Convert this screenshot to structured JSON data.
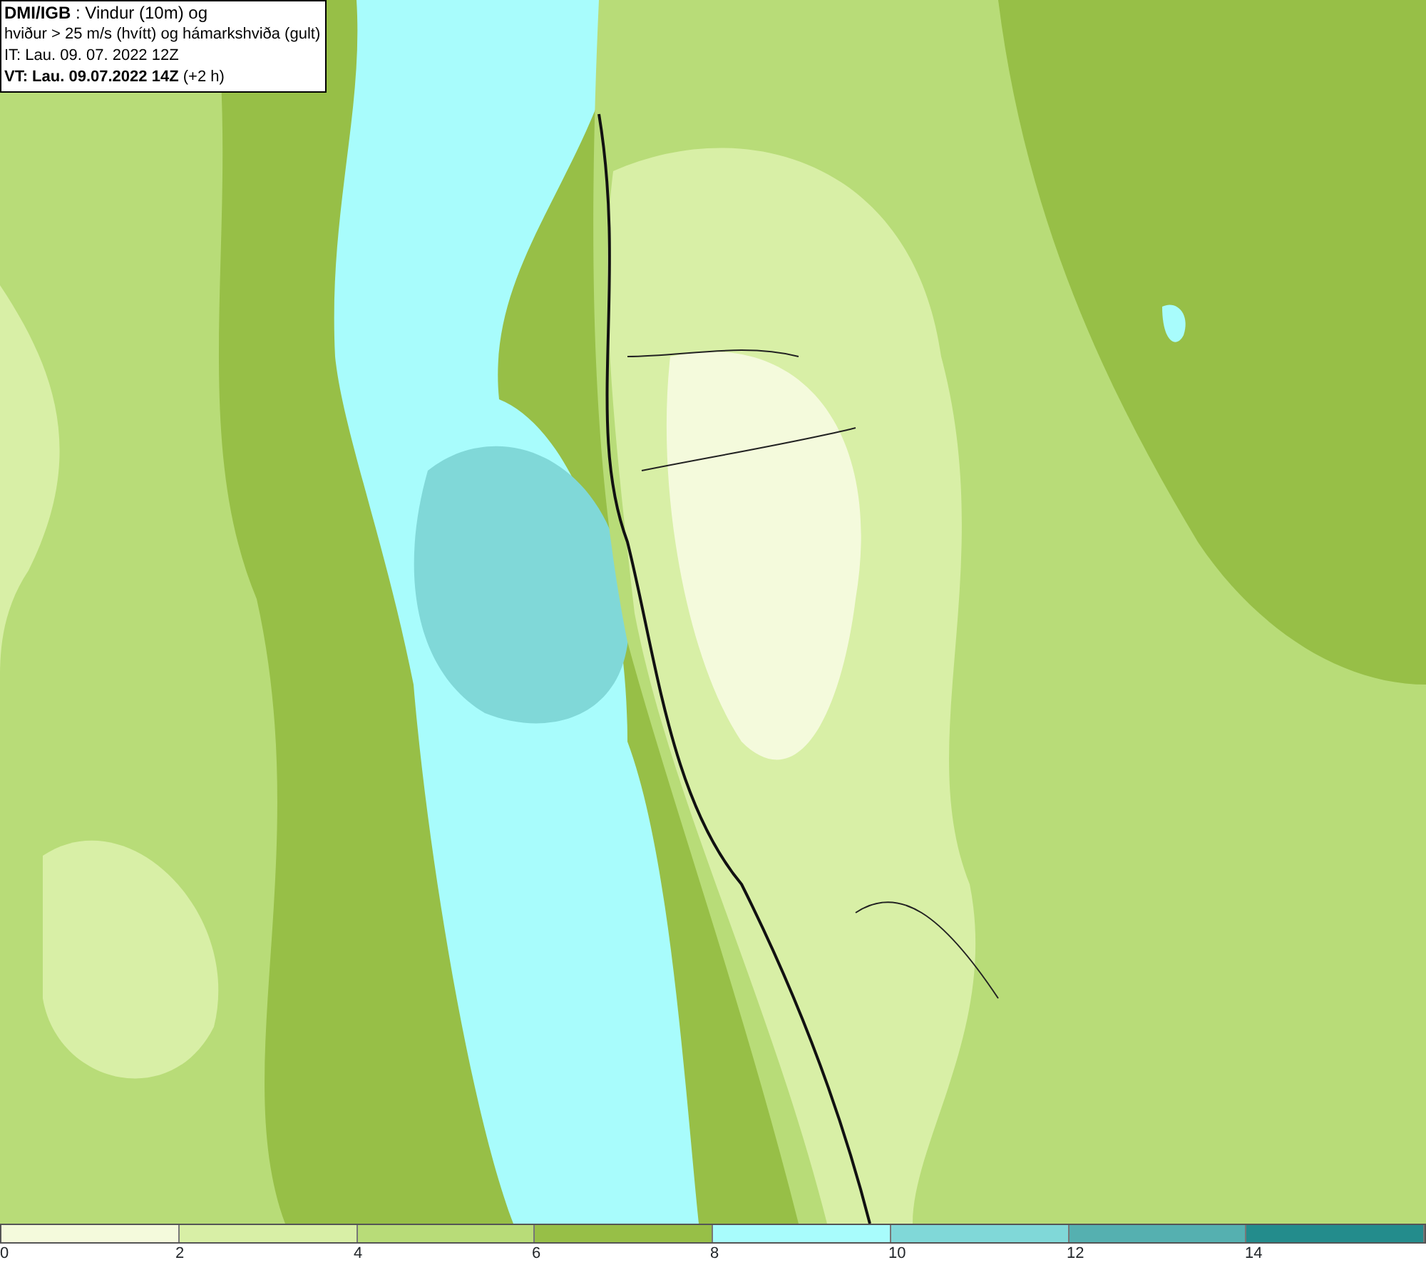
{
  "header": {
    "lines": [
      "**DMI/IGB** : Vindur (10m) og",
      "hviður > 25 m/s (hvítt) og hámarkshviða (gult)",
      "IT: Lau. 09. 07. 2022 12Z",
      "**VT: Lau. 09.07.2022 14Z** (+2 h)"
    ]
  },
  "legend": [
    {
      "label": "0",
      "color": "#f4fadc"
    },
    {
      "label": "2",
      "color": "#d8efa6"
    },
    {
      "label": "4",
      "color": "#b8dc78"
    },
    {
      "label": "6",
      "color": "#97bf47"
    },
    {
      "label": "8",
      "color": "#a8fcfc"
    },
    {
      "label": "10",
      "color": "#80d8d8"
    },
    {
      "label": "12",
      "color": "#55b0b0"
    },
    {
      "label": "14",
      "color": "#238c8c"
    }
  ]
}
